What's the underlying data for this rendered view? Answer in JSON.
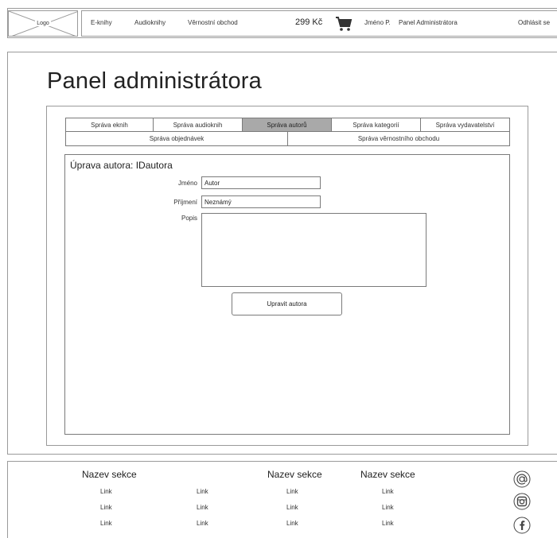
{
  "header": {
    "logo_label": "Logo",
    "nav": {
      "ebooks": "E-knihy",
      "audiobooks": "Audioknihy",
      "loyalty_shop": "Věrnostní obchod"
    },
    "cart_price": "299 Kč",
    "user_name": "Jméno P.",
    "admin_panel": "Panel Administrátora",
    "logout": "Odhlásit se"
  },
  "page": {
    "title": "Panel administrátora"
  },
  "tabs": {
    "row1": [
      "Správa eknih",
      "Správa audioknih",
      "Správa autorů",
      "Správa kategorií",
      "Správa vydavatelství"
    ],
    "row2": [
      "Správa objednávek",
      "Správa věrnostního obchodu"
    ],
    "active": "Správa autorů"
  },
  "form": {
    "title": "Úprava autora: IDautora",
    "first_name_label": "Jméno",
    "first_name_value": "Autor",
    "last_name_label": "Příjmení",
    "last_name_value": "Neznámý",
    "description_label": "Popis",
    "description_value": "",
    "submit_label": "Upravit autora"
  },
  "footer": {
    "sections": [
      {
        "heading": "Nazev sekce",
        "links": [
          "Link",
          "Link",
          "Link"
        ]
      },
      {
        "heading": "",
        "links": [
          "Link",
          "Link",
          "Link"
        ]
      },
      {
        "heading": "Nazev sekce",
        "links": [
          "Link",
          "Link",
          "Link"
        ]
      },
      {
        "heading": "Nazev sekce",
        "links": [
          "Link",
          "Link",
          "Link"
        ]
      }
    ],
    "social_icons": [
      "email-icon",
      "instagram-icon",
      "facebook-icon"
    ]
  },
  "colors": {
    "border": "#9a9a9a",
    "active_tab": "#a9a9a9",
    "text": "#222222"
  }
}
